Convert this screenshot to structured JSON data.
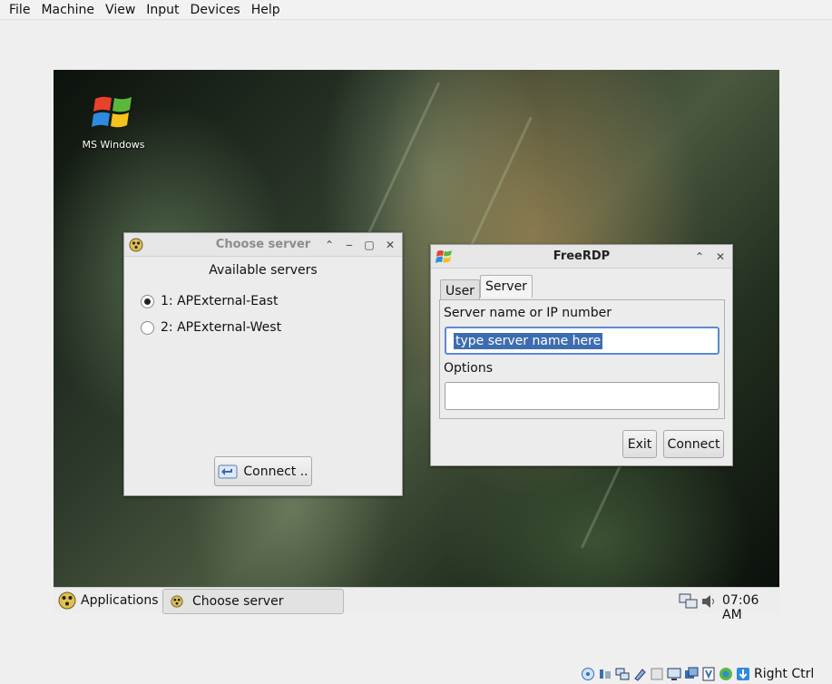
{
  "host_menu": [
    "File",
    "Machine",
    "View",
    "Input",
    "Devices",
    "Help"
  ],
  "desktop": {
    "icon_label": "MS Windows"
  },
  "choose_server": {
    "title": "Choose server",
    "heading": "Available servers",
    "servers": [
      {
        "label": "1: APExternal-East",
        "selected": true
      },
      {
        "label": "2: APExternal-West",
        "selected": false
      }
    ],
    "connect_label": "Connect .."
  },
  "freerdp": {
    "title": "FreeRDP",
    "tabs": [
      {
        "label": "User",
        "active": false
      },
      {
        "label": "Server",
        "active": true
      }
    ],
    "server_label": "Server name or IP number",
    "server_value": "type server name here",
    "options_label": "Options",
    "options_value": "",
    "exit_label": "Exit",
    "connect_label": "Connect"
  },
  "taskbar": {
    "applications_label": "Applications",
    "task_label": "Choose server",
    "clock": "07:06 AM"
  },
  "host_status": {
    "host_key": "Right Ctrl"
  },
  "colors": {
    "selection": "#3d6db0",
    "focus_border": "#5a8bd0"
  }
}
